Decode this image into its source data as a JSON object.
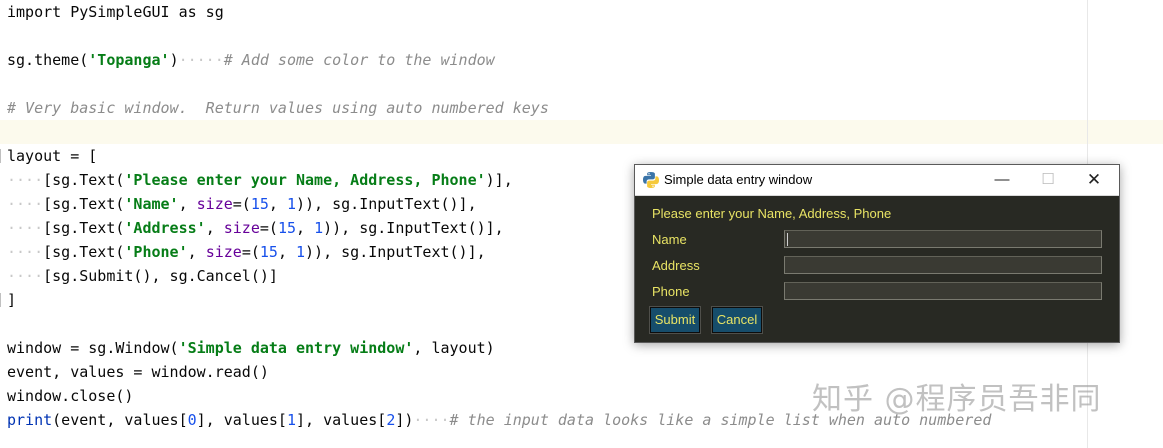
{
  "editor": {
    "lines": [
      {
        "segments": [
          {
            "t": "import PySimpleGUI as sg",
            "c": "plain"
          }
        ]
      },
      {
        "segments": [
          {
            "t": "sg.theme(",
            "c": "plain"
          },
          {
            "t": "'Topanga'",
            "c": "str"
          },
          {
            "t": ")",
            "c": "plain"
          },
          {
            "t": "·····",
            "c": "dot"
          },
          {
            "t": "# Add some color to the window",
            "c": "cmt"
          }
        ]
      },
      {
        "segments": [
          {
            "t": "# Very basic window.  Return values using auto numbered keys",
            "c": "cmt"
          }
        ]
      },
      {
        "segments": [
          {
            "t": "",
            "c": "plain"
          }
        ]
      },
      {
        "segments": [
          {
            "t": "layout = [",
            "c": "plain"
          }
        ]
      },
      {
        "segments": [
          {
            "t": "····",
            "c": "dot"
          },
          {
            "t": "[sg.Text(",
            "c": "plain"
          },
          {
            "t": "'Please enter your Name, Address, Phone'",
            "c": "str"
          },
          {
            "t": ")],",
            "c": "plain"
          }
        ]
      },
      {
        "segments": [
          {
            "t": "····",
            "c": "dot"
          },
          {
            "t": "[sg.Text(",
            "c": "plain"
          },
          {
            "t": "'Name'",
            "c": "str"
          },
          {
            "t": ", ",
            "c": "plain"
          },
          {
            "t": "size",
            "c": "param"
          },
          {
            "t": "=(",
            "c": "plain"
          },
          {
            "t": "15",
            "c": "num"
          },
          {
            "t": ", ",
            "c": "plain"
          },
          {
            "t": "1",
            "c": "num"
          },
          {
            "t": ")), sg.InputText()],",
            "c": "plain"
          }
        ]
      },
      {
        "segments": [
          {
            "t": "····",
            "c": "dot"
          },
          {
            "t": "[sg.Text(",
            "c": "plain"
          },
          {
            "t": "'Address'",
            "c": "str"
          },
          {
            "t": ", ",
            "c": "plain"
          },
          {
            "t": "size",
            "c": "param"
          },
          {
            "t": "=(",
            "c": "plain"
          },
          {
            "t": "15",
            "c": "num"
          },
          {
            "t": ", ",
            "c": "plain"
          },
          {
            "t": "1",
            "c": "num"
          },
          {
            "t": ")), sg.InputText()],",
            "c": "plain"
          }
        ]
      },
      {
        "segments": [
          {
            "t": "····",
            "c": "dot"
          },
          {
            "t": "[sg.Text(",
            "c": "plain"
          },
          {
            "t": "'Phone'",
            "c": "str"
          },
          {
            "t": ", ",
            "c": "plain"
          },
          {
            "t": "size",
            "c": "param"
          },
          {
            "t": "=(",
            "c": "plain"
          },
          {
            "t": "15",
            "c": "num"
          },
          {
            "t": ", ",
            "c": "plain"
          },
          {
            "t": "1",
            "c": "num"
          },
          {
            "t": ")), sg.InputText()],",
            "c": "plain"
          }
        ]
      },
      {
        "segments": [
          {
            "t": "····",
            "c": "dot"
          },
          {
            "t": "[sg.Submit(), sg.Cancel()]",
            "c": "plain"
          }
        ]
      },
      {
        "segments": [
          {
            "t": "]",
            "c": "plain"
          }
        ]
      },
      {
        "segments": [
          {
            "t": "",
            "c": "plain"
          }
        ]
      },
      {
        "segments": [
          {
            "t": "window = sg.Window(",
            "c": "plain"
          },
          {
            "t": "'Simple data entry window'",
            "c": "str"
          },
          {
            "t": ", layout)",
            "c": "plain"
          }
        ]
      },
      {
        "segments": [
          {
            "t": "event, values = window.read()",
            "c": "plain"
          }
        ]
      },
      {
        "segments": [
          {
            "t": "window.close()",
            "c": "plain"
          }
        ]
      },
      {
        "segments": [
          {
            "t": "print",
            "c": "kw"
          },
          {
            "t": "(event, values[",
            "c": "plain"
          },
          {
            "t": "0",
            "c": "num"
          },
          {
            "t": "], values[",
            "c": "plain"
          },
          {
            "t": "1",
            "c": "num"
          },
          {
            "t": "], values[",
            "c": "plain"
          },
          {
            "t": "2",
            "c": "num"
          },
          {
            "t": "])",
            "c": "plain"
          },
          {
            "t": "····",
            "c": "dot"
          },
          {
            "t": "# the input data looks like a simple list when auto numbered",
            "c": "cmt"
          }
        ]
      }
    ]
  },
  "window": {
    "title": "Simple data entry window",
    "minimize_glyph": "—",
    "maximize_glyph": "☐",
    "close_glyph": "✕",
    "icon": "python-logo-icon",
    "prompt": "Please enter your Name, Address, Phone",
    "fields": [
      {
        "label": "Name",
        "value": ""
      },
      {
        "label": "Address",
        "value": ""
      },
      {
        "label": "Phone",
        "value": ""
      }
    ],
    "submit_label": "Submit",
    "cancel_label": "Cancel",
    "theme_colors": {
      "background": "#282923",
      "text": "#e8e364",
      "button": "#164d6b"
    }
  },
  "watermark": "知乎 @程序员吾非同"
}
